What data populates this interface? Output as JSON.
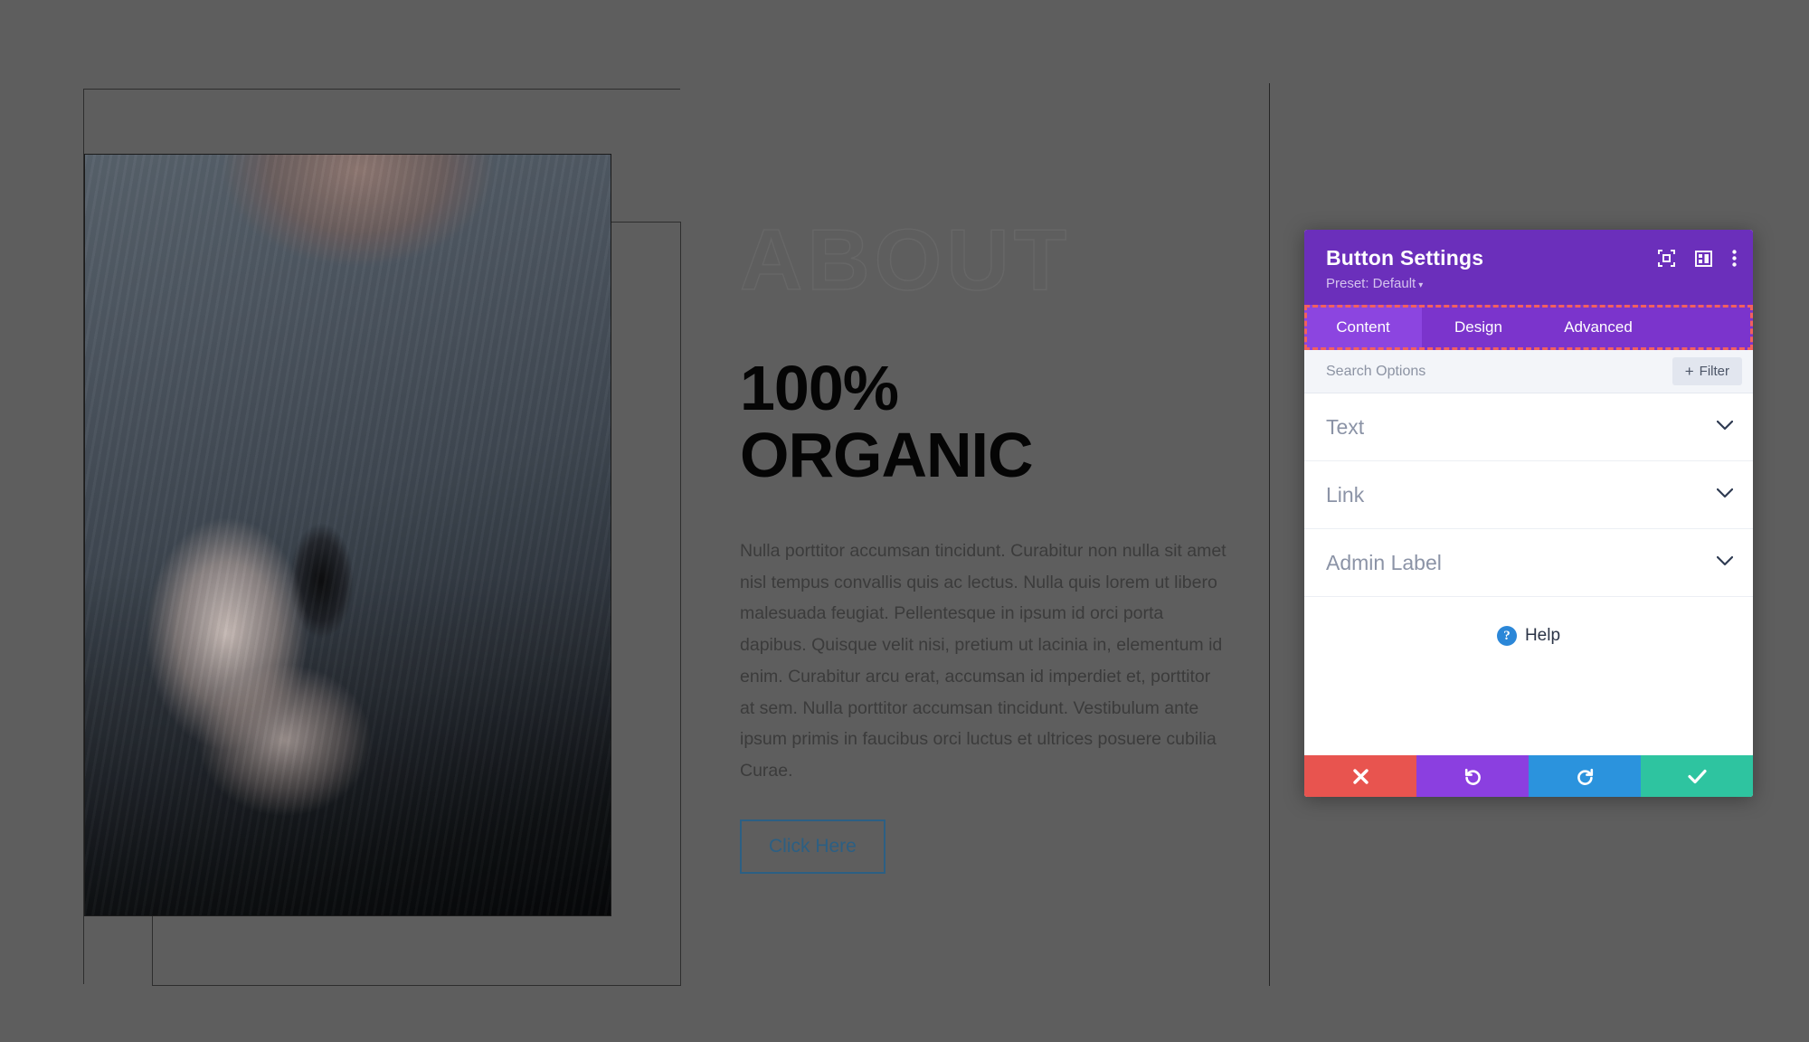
{
  "page": {
    "eyebrow": "ABOUT",
    "headline_line1": "100%",
    "headline_line2": "ORGANIC",
    "body": "Nulla porttitor accumsan tincidunt. Curabitur non nulla sit amet nisl tempus convallis quis ac lectus. Nulla quis lorem ut libero malesuada feugiat. Pellentesque in ipsum id orci porta dapibus. Quisque velit nisi, pretium ut lacinia in, elementum id enim. Curabitur arcu erat, accumsan id imperdiet et, porttitor at sem. Nulla porttitor accumsan tincidunt. Vestibulum ante ipsum primis in faucibus orci luctus et ultrices posuere cubilia Curae.",
    "cta_label": "Click Here",
    "cta_border_color": "#2c5f83"
  },
  "modal": {
    "title": "Button Settings",
    "preset_label": "Preset: Default",
    "preset_caret": "▾",
    "header_icons": [
      {
        "name": "focus-target-icon"
      },
      {
        "name": "layout-panel-icon"
      },
      {
        "name": "more-options-icon"
      }
    ],
    "tabs": [
      {
        "label": "Content",
        "active": true
      },
      {
        "label": "Design",
        "active": false
      },
      {
        "label": "Advanced",
        "active": false
      }
    ],
    "search": {
      "placeholder": "Search Options",
      "value": ""
    },
    "filter_button": {
      "label": "Filter",
      "plus": "+"
    },
    "sections": [
      {
        "label": "Text",
        "expanded": false
      },
      {
        "label": "Link",
        "expanded": false
      },
      {
        "label": "Admin Label",
        "expanded": false
      }
    ],
    "help": {
      "label": "Help",
      "badge": "?"
    },
    "footer_buttons": [
      {
        "name": "cancel-button",
        "glyph": "✕",
        "color": "#e8544f"
      },
      {
        "name": "undo-button",
        "glyph": "↺",
        "color": "#8b3fe0"
      },
      {
        "name": "redo-button",
        "glyph": "↻",
        "color": "#2b93dd"
      },
      {
        "name": "save-button",
        "glyph": "✔",
        "color": "#2ec4a0"
      }
    ],
    "colors": {
      "header_purple": "#6b2fbb",
      "tab_strip_purple": "#7b34cc",
      "active_tab_purple": "#8c45e0",
      "highlight_dashed": "#f2605e"
    }
  }
}
